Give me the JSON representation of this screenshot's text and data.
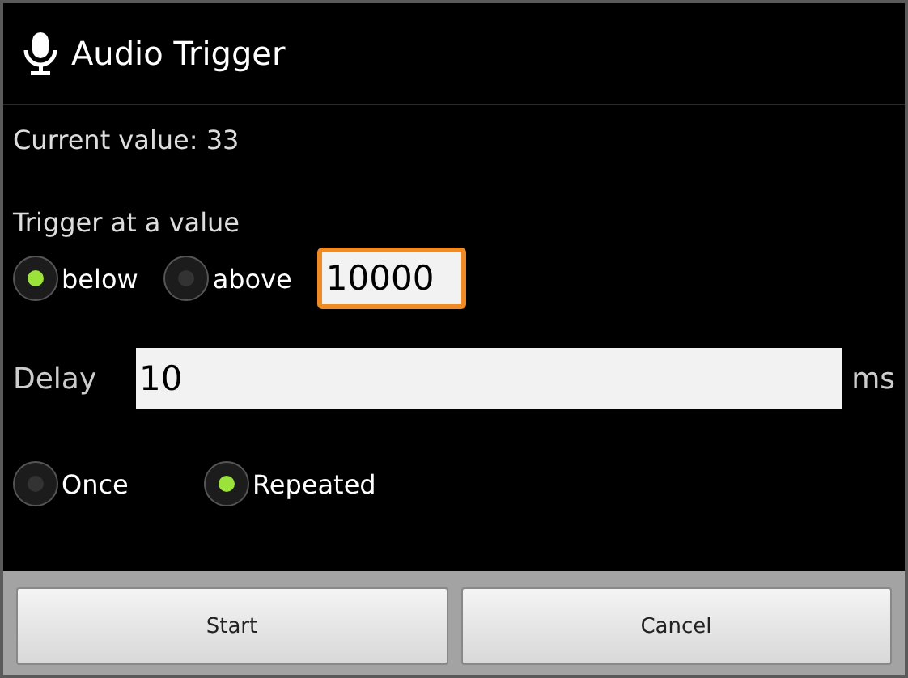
{
  "title": "Audio Trigger",
  "current_value": "Current value: 33",
  "trigger_label": "Trigger at a value",
  "direction": [
    {
      "label": "below",
      "selected": true
    },
    {
      "label": "above",
      "selected": false
    }
  ],
  "threshold": {
    "value": "10000",
    "focused": true
  },
  "delay": {
    "label": "Delay",
    "value": "10",
    "unit": "ms",
    "focused": false
  },
  "repeat": [
    {
      "label": "Once",
      "selected": false
    },
    {
      "label": "Repeated",
      "selected": true
    }
  ],
  "buttons": [
    "Start",
    "Cancel"
  ]
}
